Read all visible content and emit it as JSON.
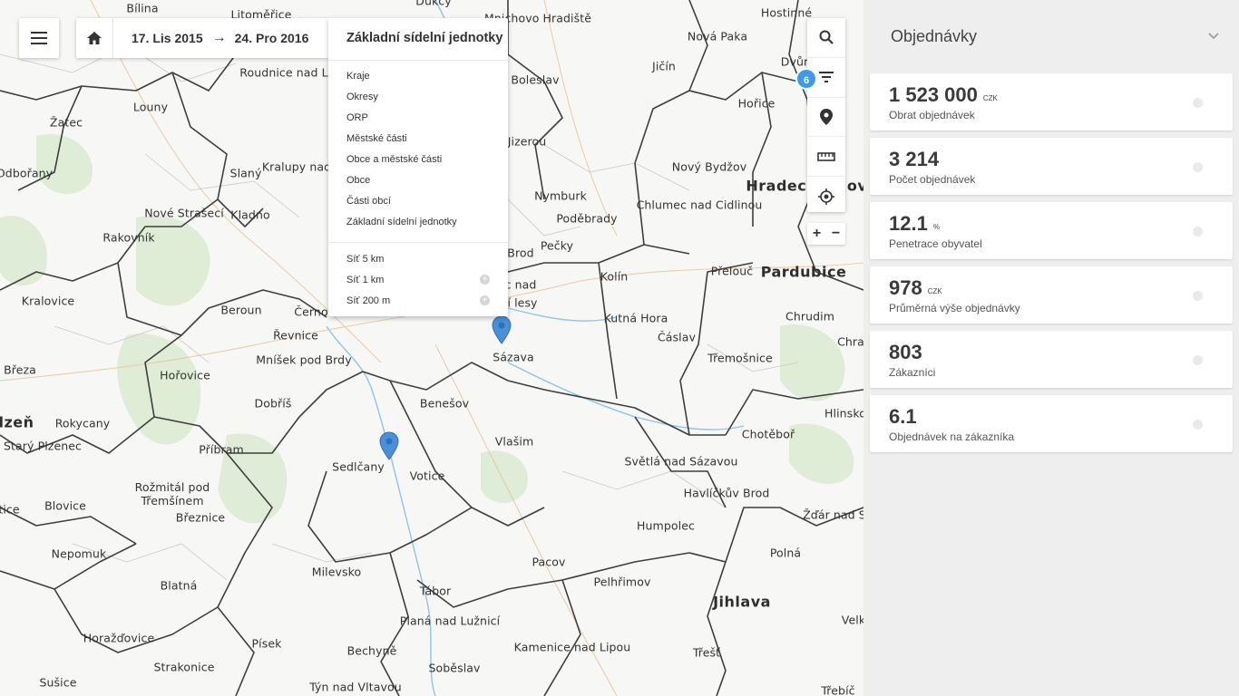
{
  "map": {
    "places": [
      {
        "name": "Bílina"
      },
      {
        "name": "Litoměřice"
      },
      {
        "name": "Mnichovo Hradiště"
      },
      {
        "name": "Dukcy"
      },
      {
        "name": "Hostinné"
      },
      {
        "name": "Nová Paka"
      },
      {
        "name": "Roudnice nad L"
      },
      {
        "name": "Boleslav"
      },
      {
        "name": "Jičín"
      },
      {
        "name": "Dvůr"
      },
      {
        "name": "Louny"
      },
      {
        "name": "Žatec"
      },
      {
        "name": "Hořice"
      },
      {
        "name": "Jizerou"
      },
      {
        "name": "Odbořany"
      },
      {
        "name": "Slaný"
      },
      {
        "name": "Kralupy nad"
      },
      {
        "name": "Nový Bydžov"
      },
      {
        "name": "Hradec Králové"
      },
      {
        "name": "Nymburk"
      },
      {
        "name": "Chlumec nad Cidlinou"
      },
      {
        "name": "Nové Strašecí"
      },
      {
        "name": "Kladno"
      },
      {
        "name": "Poděbrady"
      },
      {
        "name": "Rakovník"
      },
      {
        "name": "Brod"
      },
      {
        "name": "Pečky"
      },
      {
        "name": "Přelouč"
      },
      {
        "name": "Pardubice"
      },
      {
        "name": "Kolín"
      },
      {
        "name": "Kralovice"
      },
      {
        "name": "c nad"
      },
      {
        "name": "í lesy"
      },
      {
        "name": "Beroun"
      },
      {
        "name": "Černo"
      },
      {
        "name": "Kutná Hora"
      },
      {
        "name": "Chrudim"
      },
      {
        "name": "Řevnice"
      },
      {
        "name": "Čáslav"
      },
      {
        "name": "Sázava"
      },
      {
        "name": "Mníšek pod Brdy"
      },
      {
        "name": "Třemošnice"
      },
      {
        "name": "Chra"
      },
      {
        "name": "Hořovice"
      },
      {
        "name": "Březa"
      },
      {
        "name": "Dobříš"
      },
      {
        "name": "Benešov"
      },
      {
        "name": "Hlinsko"
      },
      {
        "name": "lzeň"
      },
      {
        "name": "Rokycany"
      },
      {
        "name": "Starý Plzenec"
      },
      {
        "name": "Vlašim"
      },
      {
        "name": "Chotěboř"
      },
      {
        "name": "Příbram"
      },
      {
        "name": "Světlá nad Sázavou"
      },
      {
        "name": "Sedlčany"
      },
      {
        "name": "Votice"
      },
      {
        "name": "Rožmitál pod Třemšínem"
      },
      {
        "name": "Havlíčkův Brod"
      },
      {
        "name": "Blovice"
      },
      {
        "name": "Žďár nad S"
      },
      {
        "name": "Březnice"
      },
      {
        "name": "tice"
      },
      {
        "name": "Humpolec"
      },
      {
        "name": "Nepomuk"
      },
      {
        "name": "Pacov"
      },
      {
        "name": "Polná"
      },
      {
        "name": "Milevsko"
      },
      {
        "name": "Pelhřimov"
      },
      {
        "name": "Blatná"
      },
      {
        "name": "Jihlava"
      },
      {
        "name": "Tábor"
      },
      {
        "name": "Velk"
      },
      {
        "name": "Planá nad Lužnicí"
      },
      {
        "name": "Horažďovice"
      },
      {
        "name": "Písek"
      },
      {
        "name": "Kamenice nad Lipou"
      },
      {
        "name": "Bechyně"
      },
      {
        "name": "Třešť"
      },
      {
        "name": "Strakonice"
      },
      {
        "name": "Soběslav"
      },
      {
        "name": "Sušice"
      },
      {
        "name": "Týn nad Vltavou"
      },
      {
        "name": "Třebíč"
      }
    ]
  },
  "topbar": {
    "date_from": "17. Lis 2015",
    "arrow": "→",
    "date_to": "24. Pro 2016"
  },
  "dropdown": {
    "title": "Základní sídelní jednotky",
    "admin_items": [
      "Kraje",
      "Okresy",
      "ORP",
      "Městské části",
      "Obce a městské části",
      "Obce",
      "Části obcí",
      "Základní sídelní jednotky"
    ],
    "grid_items": [
      "Síť 5 km",
      "Síť 1 km",
      "Síť 200 m"
    ],
    "plus_symbol": "+"
  },
  "tools": {
    "filter_count": "6",
    "zoom_in": "+",
    "zoom_out": "−"
  },
  "panel": {
    "title": "Objednávky",
    "kpis": [
      {
        "value": "1 523 000",
        "unit": "CZK",
        "label": "Obrat objednávek"
      },
      {
        "value": "3 214",
        "unit": "",
        "label": "Počet objednávek"
      },
      {
        "value": "12.1",
        "unit": "%",
        "label": "Penetrace obyvatel"
      },
      {
        "value": "978",
        "unit": "CZK",
        "label": "Průměrná výše objednávky"
      },
      {
        "value": "803",
        "unit": "",
        "label": "Zákazníci"
      },
      {
        "value": "6.1",
        "unit": "",
        "label": "Objednávek na zákazníka"
      }
    ]
  },
  "colors": {
    "accent": "#3d9ae8",
    "pin": "#4a8fd9",
    "panel_bg": "#eeeeee"
  }
}
